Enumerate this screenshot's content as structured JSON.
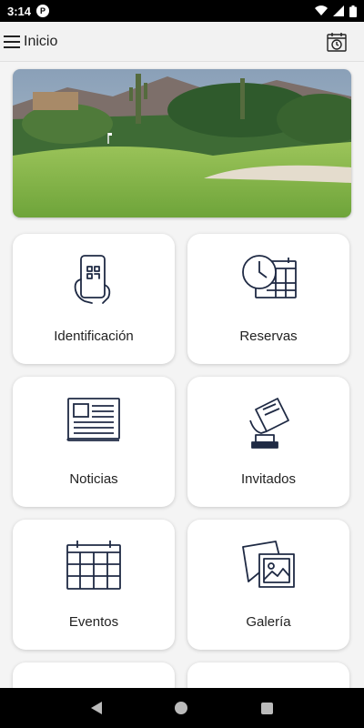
{
  "status_bar": {
    "time": "3:14",
    "notification_icon": "P"
  },
  "app_bar": {
    "title": "Inicio",
    "menu_icon": "hamburger-icon",
    "action_icon": "calendar-clock-icon"
  },
  "hero": {
    "image": "golf-course-desert"
  },
  "tiles": [
    {
      "label": "Identificación",
      "icon": "phone-qr-icon"
    },
    {
      "label": "Reservas",
      "icon": "clock-calendar-icon"
    },
    {
      "label": "Noticias",
      "icon": "newspaper-icon"
    },
    {
      "label": "Invitados",
      "icon": "guest-card-icon"
    },
    {
      "label": "Eventos",
      "icon": "calendar-icon"
    },
    {
      "label": "Galería",
      "icon": "gallery-icon"
    }
  ],
  "colors": {
    "icon_stroke": "#1f2a44",
    "card_bg": "#ffffff",
    "page_bg": "#f4f4f4"
  }
}
